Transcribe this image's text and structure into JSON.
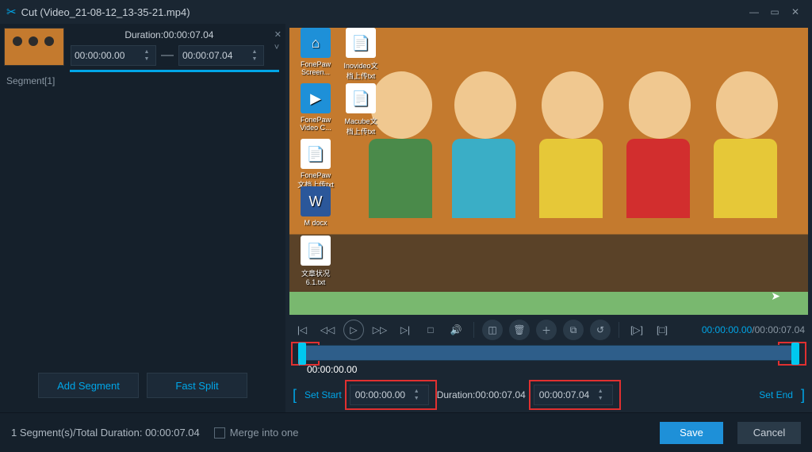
{
  "title": "Cut (Video_21-08-12_13-35-21.mp4)",
  "segment": {
    "label": "Segment[1]",
    "durationLabel": "Duration:00:00:07.04",
    "start": "00:00:00.00",
    "end": "00:00:07.04"
  },
  "leftButtons": {
    "add": "Add Segment",
    "split": "Fast Split"
  },
  "playback": {
    "current": "00:00:00.00",
    "total": "00:00:07.04"
  },
  "timeline": {
    "marker": "00:00:00.00"
  },
  "setRow": {
    "setStart": "Set Start",
    "startVal": "00:00:00.00",
    "durationLabel": "Duration:00:00:07.04",
    "endVal": "00:00:07.04",
    "setEnd": "Set End"
  },
  "footer": {
    "summary": "1 Segment(s)/Total Duration: 00:00:07.04",
    "merge": "Merge into one",
    "save": "Save",
    "cancel": "Cancel"
  },
  "desktop": [
    {
      "label": "FonePaw Screen...",
      "t": 38,
      "l": 398,
      "bg": "#1e90d8",
      "glyph": "⌂"
    },
    {
      "label": "Inovideo文档上传txt",
      "t": 38,
      "l": 455,
      "bg": "#fff",
      "glyph": "📄"
    },
    {
      "label": "FonePaw Video C...",
      "t": 108,
      "l": 398,
      "bg": "#1e90d8",
      "glyph": "▶"
    },
    {
      "label": "Macube文档上传txt",
      "t": 108,
      "l": 455,
      "bg": "#fff",
      "glyph": "📄"
    },
    {
      "label": "FonePaw文档上传txt",
      "t": 178,
      "l": 398,
      "bg": "#fff",
      "glyph": "📄"
    },
    {
      "label": "M docx",
      "t": 238,
      "l": 398,
      "bg": "#2b579a",
      "glyph": "W"
    },
    {
      "label": "文章状况 6.1.txt",
      "t": 300,
      "l": 398,
      "bg": "#fff",
      "glyph": "📄"
    }
  ]
}
